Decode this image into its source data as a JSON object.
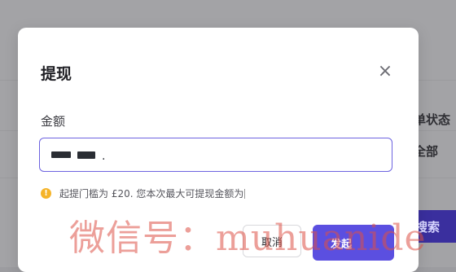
{
  "background": {
    "right_col_texts": [
      "单状态",
      "全部"
    ],
    "right_btn": "搜索"
  },
  "modal": {
    "title": "提现",
    "close_icon": "×",
    "amount_label": "金额",
    "amount_value_note": "redacted",
    "hint_text": "起提门槛为 £20. 您本次最大可提现金额为",
    "cancel_label": "取消",
    "submit_label": "发起"
  },
  "watermark": "微信号：muhuanide",
  "colors": {
    "primary": "#5b4fe0",
    "input_border": "#6d63e0",
    "warning": "#f5b42a",
    "watermark": "#dc5046"
  }
}
